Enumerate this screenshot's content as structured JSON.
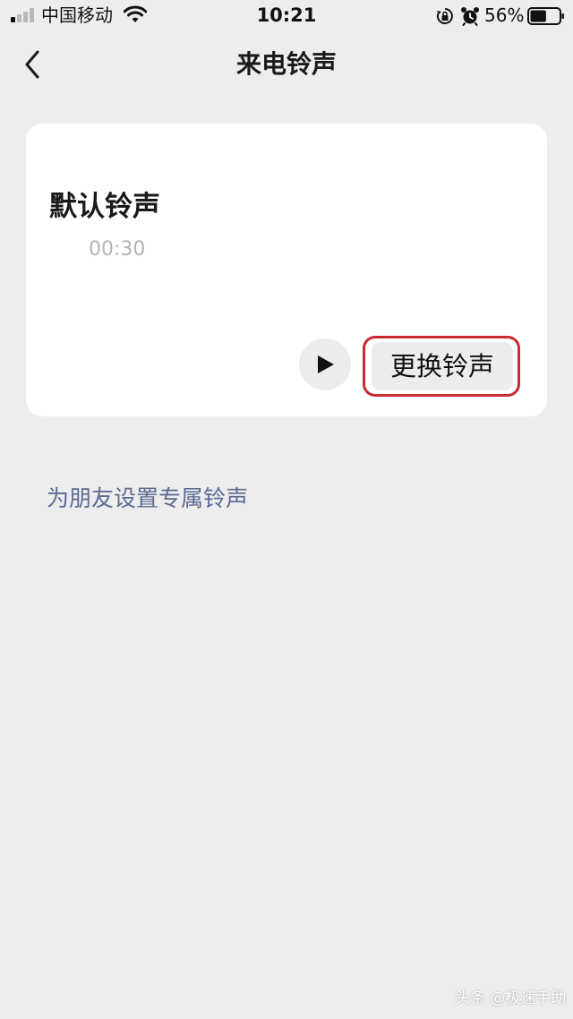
{
  "status_bar": {
    "carrier": "中国移动",
    "time": "10:21",
    "battery_percent": "56%",
    "battery_level": 0.56,
    "signal_bars_active": 1,
    "icons": [
      "signal-icon",
      "wifi-icon",
      "orientation-lock-icon",
      "alarm-icon",
      "battery-icon"
    ]
  },
  "nav": {
    "title": "来电铃声",
    "back_icon": "chevron-left-icon"
  },
  "ringtone_card": {
    "name": "默认铃声",
    "duration": "00:30",
    "play_icon": "play-icon",
    "change_button_label": "更换铃声",
    "highlight_color": "#c92a33"
  },
  "friend_ringtone_link": "为朋友设置专属铃声",
  "watermark": "头条 @极速手助",
  "colors": {
    "background": "#ededed",
    "card": "#ffffff",
    "link": "#5b6a92",
    "muted_text": "#b4b4b4"
  }
}
